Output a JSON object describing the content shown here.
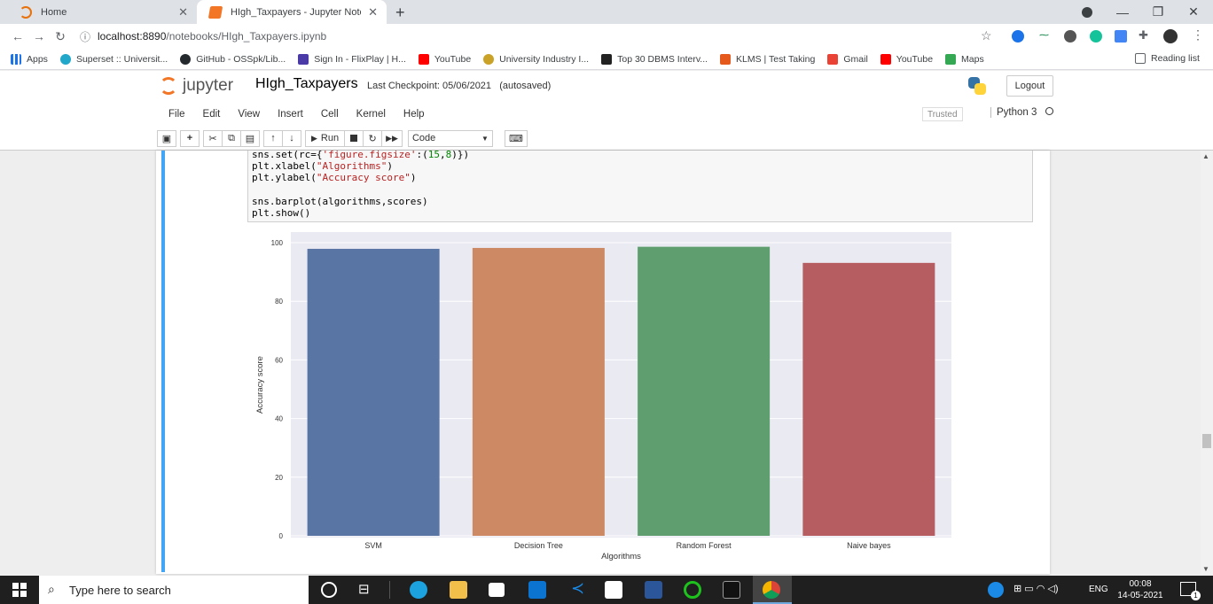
{
  "browser": {
    "tabs": [
      {
        "title": "Home",
        "active": false
      },
      {
        "title": "HIgh_Taxpayers - Jupyter Notebo",
        "active": true
      }
    ],
    "new_tab": "+",
    "url_host": "localhost:8890",
    "url_path": "/notebooks/HIgh_Taxpayers.ipynb",
    "bookmarks": [
      "Apps",
      "Superset :: Universit...",
      "GitHub - OSSpk/Lib...",
      "Sign In - FlixPlay | H...",
      "YouTube",
      "University Industry I...",
      "Top 30 DBMS Interv...",
      "KLMS | Test Taking",
      "Gmail",
      "YouTube",
      "Maps"
    ],
    "reading_list": "Reading list"
  },
  "jupyter": {
    "logo_text": "jupyter",
    "notebook_name": "HIgh_Taxpayers",
    "checkpoint": "Last Checkpoint: 05/06/2021",
    "autosaved": "(autosaved)",
    "logout": "Logout",
    "menus": [
      "File",
      "Edit",
      "View",
      "Insert",
      "Cell",
      "Kernel",
      "Help"
    ],
    "trusted": "Trusted",
    "kernel": "Python 3",
    "run_label": "Run",
    "cell_type": "Code"
  },
  "code_lines": [
    "sns.set(rc={'figure.figsize':(15,8)})",
    "plt.xlabel(\"Algorithms\")",
    "plt.ylabel(\"Accuracy score\")",
    "",
    "sns.barplot(algorithms,scores)",
    "plt.show()"
  ],
  "chart_data": {
    "type": "bar",
    "categories": [
      "SVM",
      "Decision Tree",
      "Random Forest",
      "Naive bayes"
    ],
    "values": [
      97.9,
      98.2,
      98.6,
      93.1
    ],
    "colors": [
      "#5975a4",
      "#cc8963",
      "#5f9e6e",
      "#b55d60"
    ],
    "xlabel": "Algorithms",
    "ylabel": "Accuracy score",
    "ylim": [
      0,
      101
    ],
    "yticks": [
      0,
      20,
      40,
      60,
      80,
      100
    ],
    "background": "#eaeaf2",
    "grid": true
  },
  "taskbar": {
    "search_placeholder": "Type here to search",
    "lang": "ENG",
    "time": "00:08",
    "date": "14-05-2021",
    "notif_count": "1"
  }
}
